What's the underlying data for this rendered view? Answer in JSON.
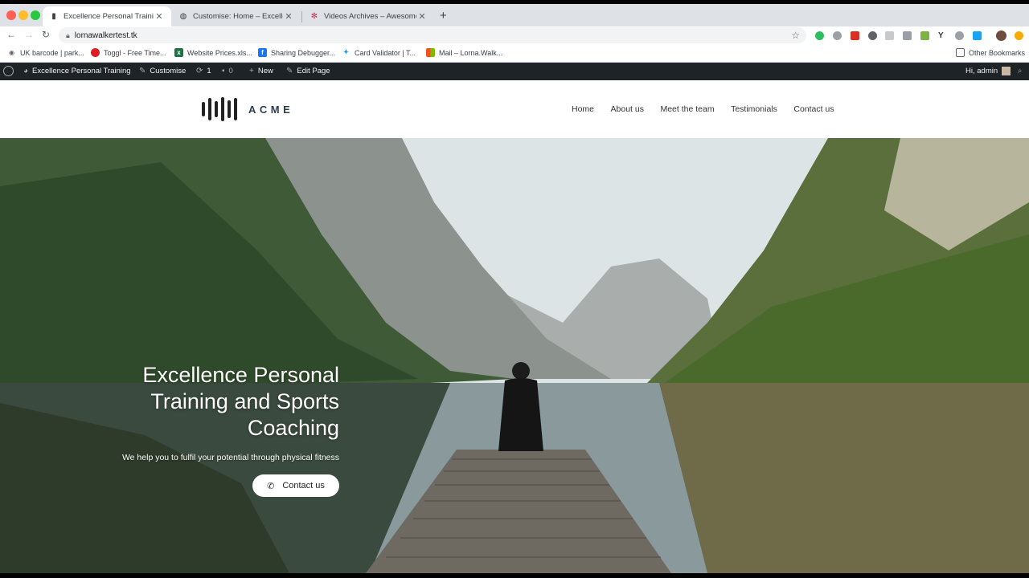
{
  "browser": {
    "tabs": [
      {
        "title": "Excellence Personal Training –",
        "active": true
      },
      {
        "title": "Customise: Home – Excellence",
        "active": false
      },
      {
        "title": "Videos Archives – Awesome Te",
        "active": false
      }
    ],
    "url": "lornawalkertest.tk",
    "bookmarks": [
      "UK barcode | park...",
      "Toggl - Free Time...",
      "Website Prices.xls...",
      "Sharing Debugger...",
      "Card Validator | T...",
      "Mail – Lorna.Walk..."
    ],
    "other_bookmarks": "Other Bookmarks"
  },
  "wp_admin_bar": {
    "site_name": "Excellence Personal Training",
    "customise": "Customise",
    "updates_count": "1",
    "comments_count": "0",
    "new": "New",
    "edit_page": "Edit Page",
    "greeting": "Hi, admin"
  },
  "site": {
    "logo_text": "ACME",
    "menu": [
      "Home",
      "About us",
      "Meet the team",
      "Testimonials",
      "Contact us"
    ]
  },
  "hero": {
    "title_lines": [
      "Excellence Personal",
      "Training and Sports",
      "Coaching"
    ],
    "subtitle": "We help you to fulfil your potential through physical fitness",
    "button_label": "Contact us"
  },
  "colors": {
    "wp_bar": "#1d2327",
    "tabbar": "#dee1e6"
  }
}
